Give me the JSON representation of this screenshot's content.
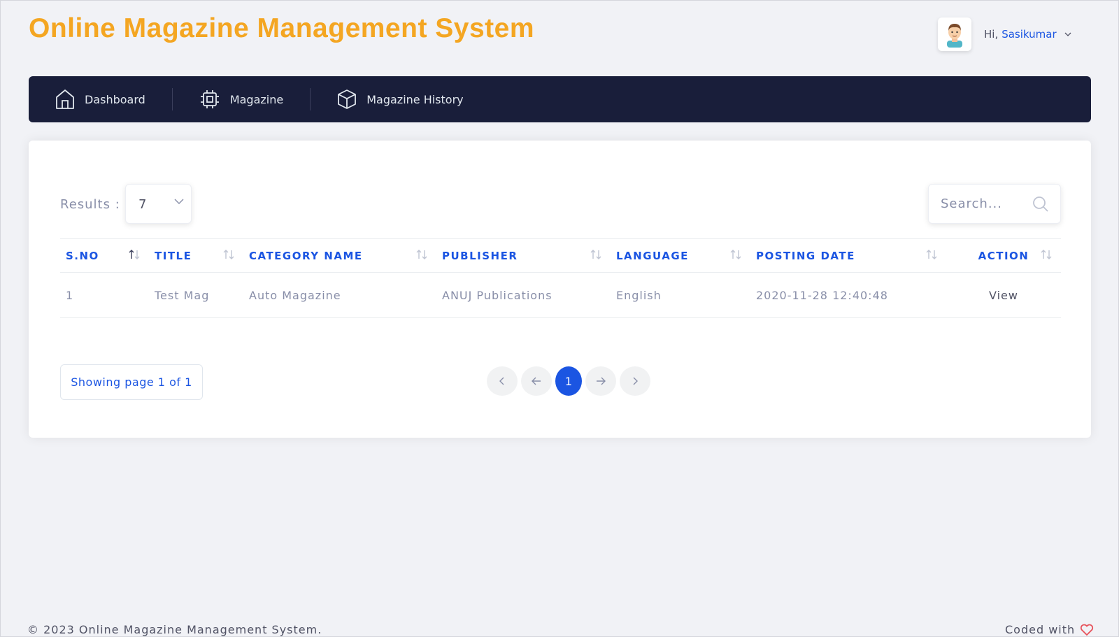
{
  "app": {
    "title": "Online Magazine Management System"
  },
  "user": {
    "greeting": "Hi,",
    "name": "Sasikumar"
  },
  "nav": {
    "items": [
      {
        "label": "Dashboard",
        "icon": "home-icon"
      },
      {
        "label": "Magazine",
        "icon": "cpu-icon"
      },
      {
        "label": "Magazine History",
        "icon": "box-icon"
      }
    ]
  },
  "table_controls": {
    "results_label": "Results :",
    "results_value": "7",
    "search_placeholder": "Search..."
  },
  "table": {
    "columns": [
      "S.NO",
      "TITLE",
      "CATEGORY NAME",
      "PUBLISHER",
      "LANGUAGE",
      "POSTING DATE",
      "ACTION"
    ],
    "rows": [
      [
        "1",
        "Test Mag",
        "Auto Magazine",
        "ANUJ Publications",
        "English",
        "2020-11-28 12:40:48",
        "View"
      ]
    ]
  },
  "pagination": {
    "info": "Showing page 1 of 1",
    "current_page": "1"
  },
  "footer": {
    "copyright": "© 2023 Online Magazine Management System.",
    "coded_with": "Coded with"
  },
  "colors": {
    "accent_orange": "#f4a622",
    "primary_blue": "#1b55e2",
    "navbar_bg": "#191e3a",
    "heart": "#e7515a"
  }
}
